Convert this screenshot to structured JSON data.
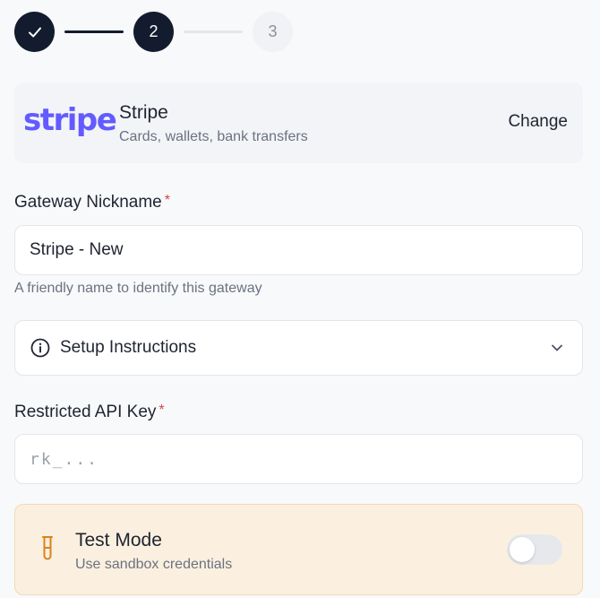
{
  "stepper": {
    "steps": [
      {
        "label": "",
        "state": "done",
        "icon": "check-icon"
      },
      {
        "label": "2",
        "state": "active"
      },
      {
        "label": "3",
        "state": "pending"
      }
    ]
  },
  "provider": {
    "logo_text": "stripe",
    "name": "Stripe",
    "description": "Cards, wallets, bank transfers",
    "change_label": "Change",
    "brand_color": "#635bff"
  },
  "nickname": {
    "label": "Gateway Nickname",
    "required_mark": "*",
    "value": "Stripe - New",
    "helper": "A friendly name to identify this gateway"
  },
  "setup": {
    "label": "Setup Instructions",
    "icon": "info-icon",
    "expanded": false
  },
  "api_key": {
    "label": "Restricted API Key",
    "required_mark": "*",
    "placeholder": "rk_...",
    "value": ""
  },
  "test_mode": {
    "title": "Test Mode",
    "description": "Use sandbox credentials",
    "icon": "test-tube-icon",
    "enabled": false,
    "accent_color": "#d9821e"
  }
}
